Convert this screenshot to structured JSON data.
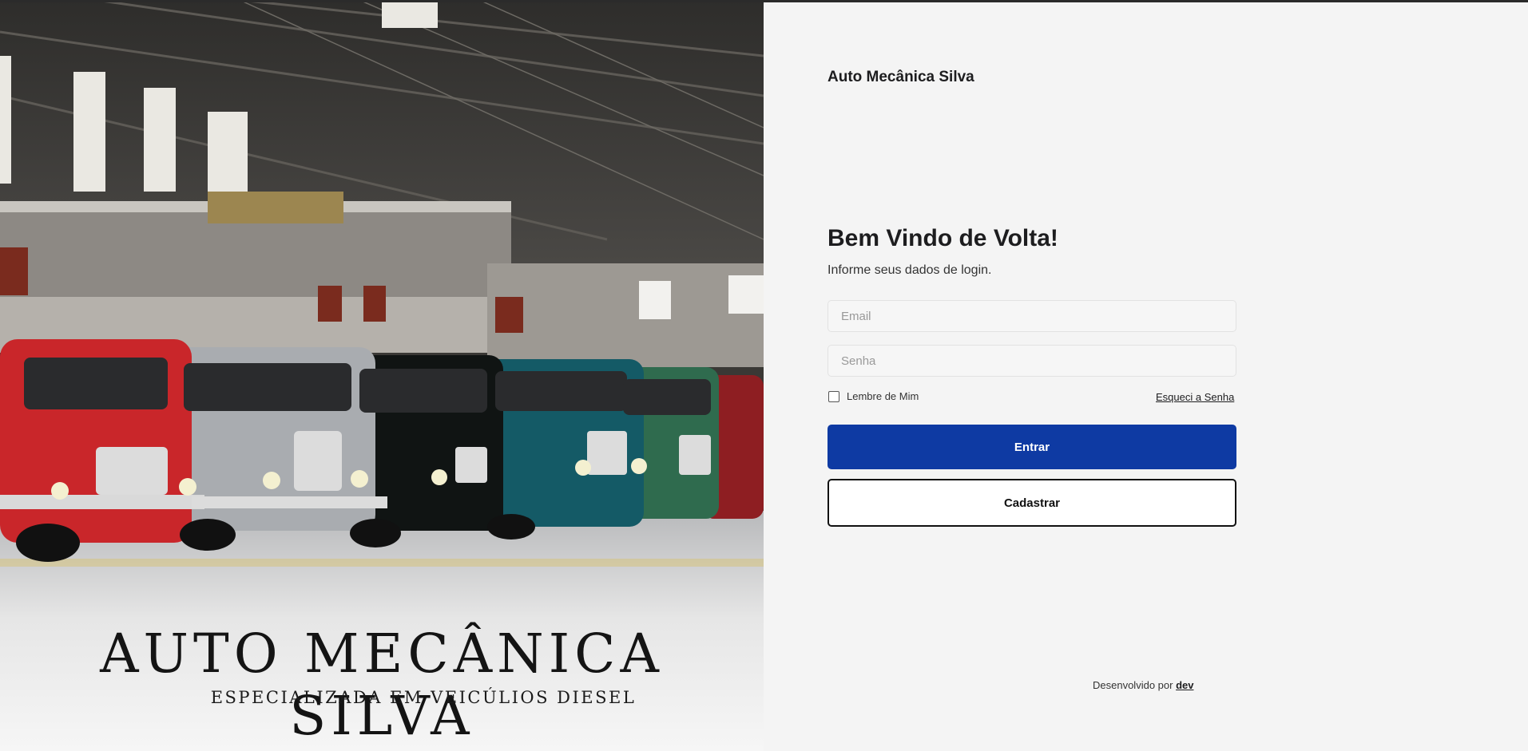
{
  "hero": {
    "title": "AUTO MECÂNICA SILVA",
    "subtitle": "ESPECIALIZADA EM VEICÚLIOS DIESEL"
  },
  "login": {
    "brand": "Auto Mecânica Silva",
    "heading": "Bem Vindo de Volta!",
    "subheading": "Informe seus dados de login.",
    "email_placeholder": "Email",
    "password_placeholder": "Senha",
    "remember_label": "Lembre de Mim",
    "forgot_label": "Esqueci a Senha",
    "submit_label": "Entrar",
    "register_label": "Cadastrar"
  },
  "footer": {
    "prefix": "Desenvolvido por",
    "link": "dev"
  },
  "colors": {
    "primary": "#0e3aa3",
    "background": "#f4f4f4"
  }
}
